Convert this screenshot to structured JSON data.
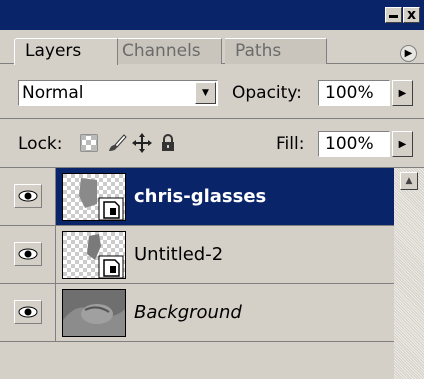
{
  "window": {
    "minimize_icon": "minimize-icon",
    "close_label": "x"
  },
  "tabs": [
    {
      "label": "Layers",
      "active": true
    },
    {
      "label": "Channels",
      "active": false
    },
    {
      "label": "Paths",
      "active": false
    }
  ],
  "panel_menu_icon": "play-arrow-icon",
  "blend": {
    "mode": "Normal",
    "opacity_label": "Opacity:",
    "opacity_value": "100%"
  },
  "lock": {
    "label": "Lock:",
    "icons": [
      "transparency-lock-icon",
      "brush-lock-icon",
      "move-lock-icon",
      "padlock-icon"
    ],
    "fill_label": "Fill:",
    "fill_value": "100%"
  },
  "layers": [
    {
      "name": "chris-glasses",
      "selected": true,
      "visible": true,
      "style": "bold"
    },
    {
      "name": "Untitled-2",
      "selected": false,
      "visible": true,
      "style": "normal"
    },
    {
      "name": "Background",
      "selected": false,
      "visible": true,
      "style": "italic"
    }
  ],
  "colors": {
    "selection": "#0a246a",
    "panel": "#d4d0c8"
  }
}
